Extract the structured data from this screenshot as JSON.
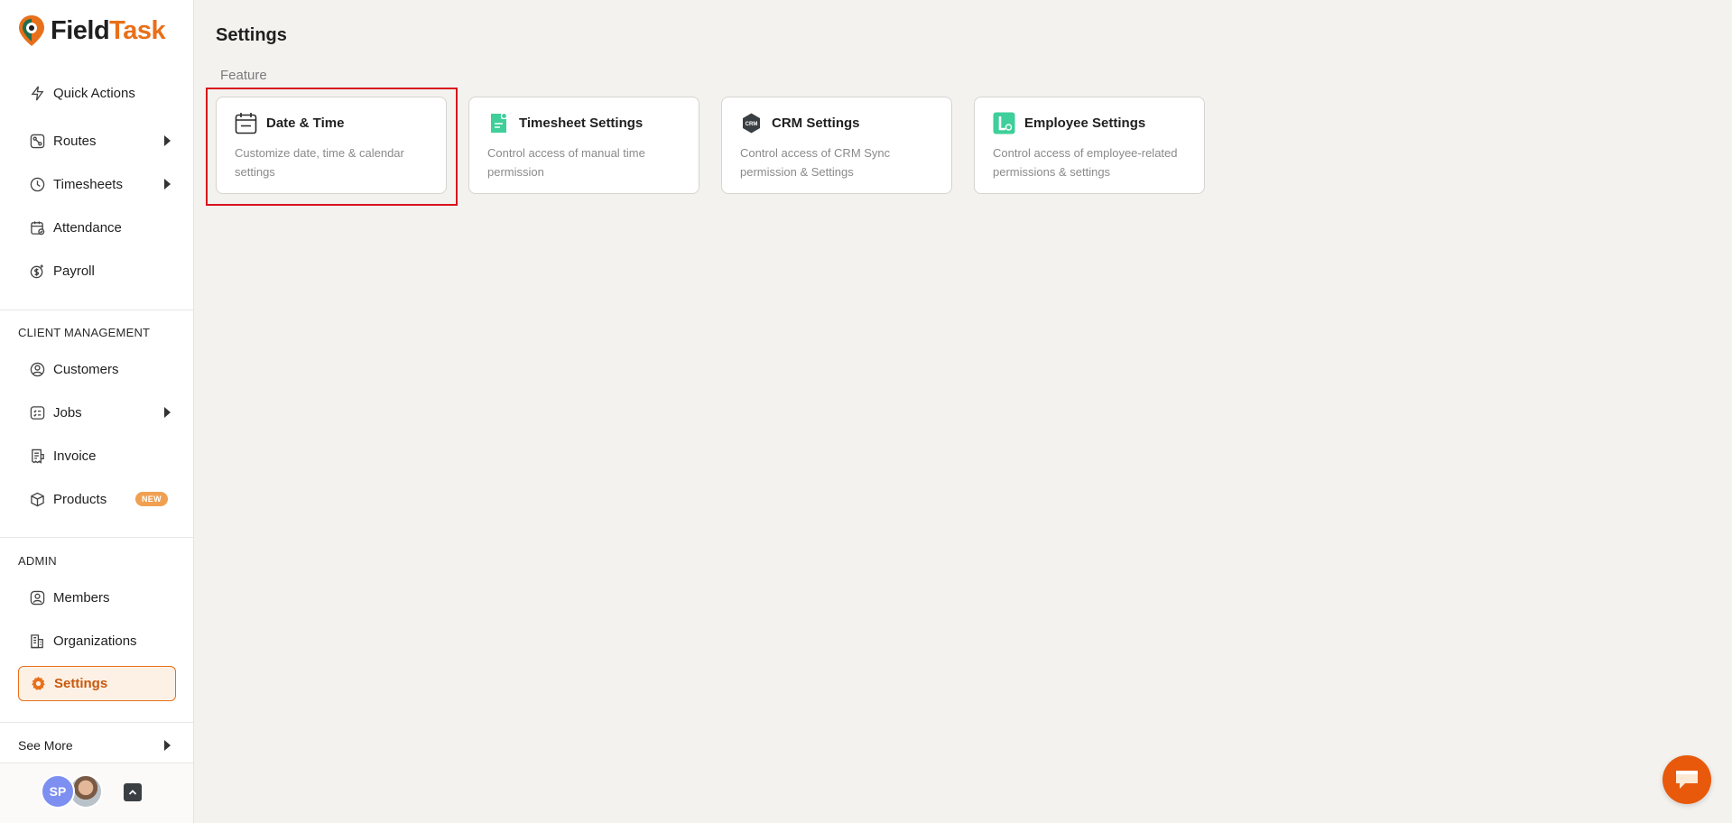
{
  "brand": {
    "name_part1": "Field",
    "name_part2": "Task"
  },
  "sidebar": {
    "items": [
      {
        "label": "Quick Actions",
        "icon": "lightning-icon"
      },
      {
        "label": "Routes",
        "icon": "route-icon"
      },
      {
        "label": "Timesheets",
        "icon": "clock-icon"
      },
      {
        "label": "Attendance",
        "icon": "calendar-check-icon"
      },
      {
        "label": "Payroll",
        "icon": "dollar-icon"
      }
    ],
    "client_section_label": "CLIENT MANAGEMENT",
    "client_items": [
      {
        "label": "Customers",
        "icon": "user-circle-icon"
      },
      {
        "label": "Jobs",
        "icon": "jobs-icon"
      },
      {
        "label": "Invoice",
        "icon": "invoice-icon"
      },
      {
        "label": "Products",
        "icon": "box-icon",
        "badge": "NEW"
      }
    ],
    "admin_section_label": "ADMIN",
    "admin_items": [
      {
        "label": "Members",
        "icon": "member-icon"
      },
      {
        "label": "Organizations",
        "icon": "organization-icon"
      },
      {
        "label": "Settings",
        "icon": "gear-icon",
        "active": true
      }
    ],
    "see_more": "See More",
    "user_initials": "SP"
  },
  "main": {
    "title": "Settings",
    "section_label": "Feature",
    "cards": [
      {
        "title": "Date & Time",
        "description": "Customize date, time & calendar settings",
        "icon": "calendar-icon"
      },
      {
        "title": "Timesheet Settings",
        "description": "Control access of manual time permission",
        "icon": "timesheet-doc-icon"
      },
      {
        "title": "CRM Settings",
        "description": "Control access of CRM Sync permission & Settings",
        "icon": "crm-icon",
        "icon_text": "CRM"
      },
      {
        "title": "Employee Settings",
        "description": "Control access of employee-related permissions & settings",
        "icon": "employee-icon"
      }
    ]
  },
  "colors": {
    "accent": "#e8701a",
    "highlight": "#d8131c",
    "mint": "#3ecf9a",
    "chat": "#e8590c"
  }
}
